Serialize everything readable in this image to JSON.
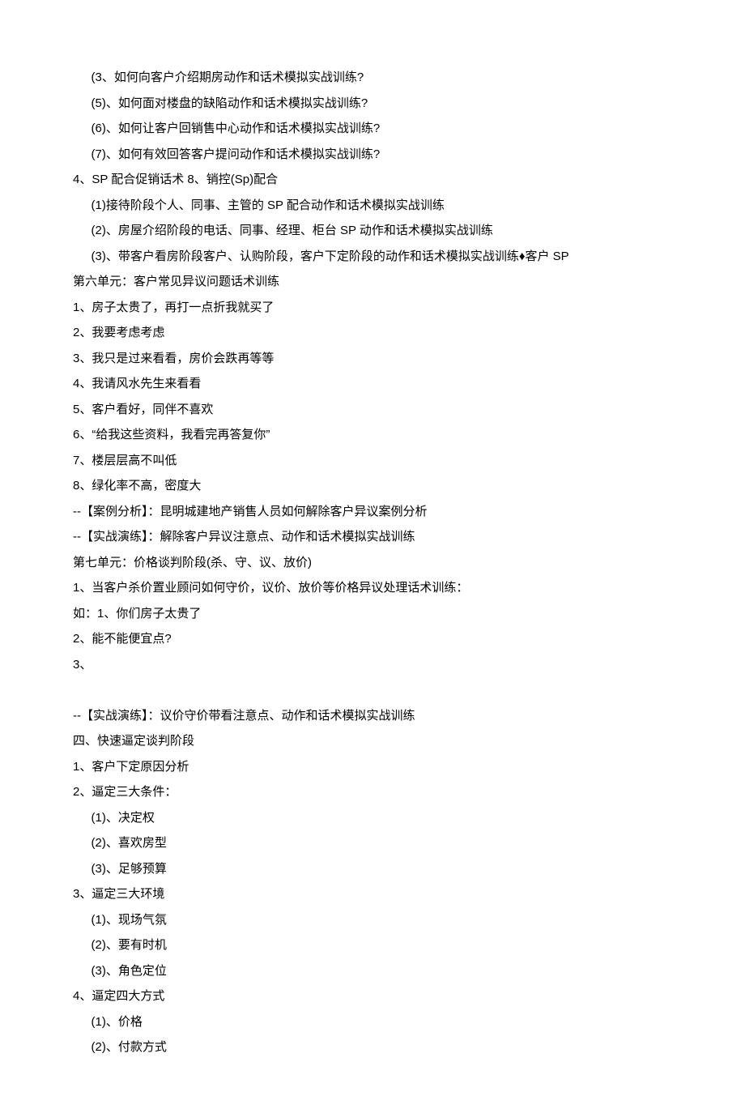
{
  "lines": [
    {
      "text": "(3、如何向客户介绍期房动作和话术模拟实战训练?",
      "indent": 1
    },
    {
      "text": "(5)、如何面对楼盘的缺陷动作和话术模拟实战训练?",
      "indent": 1
    },
    {
      "text": "(6)、如何让客户回销售中心动作和话术模拟实战训练?",
      "indent": 1
    },
    {
      "text": "(7)、如何有效回答客户提问动作和话术模拟实战训练?",
      "indent": 1
    },
    {
      "text": "4、SP 配合促销话术 8、销控(Sp)配合",
      "indent": 0
    },
    {
      "text": "(1)接待阶段个人、同事、主管的 SP 配合动作和话术模拟实战训练",
      "indent": 1
    },
    {
      "text": "(2)、房屋介绍阶段的电话、同事、经理、柜台 SP 动作和话术模拟实战训练",
      "indent": 1
    },
    {
      "text": "(3)、带客户看房阶段客户、认购阶段，客户下定阶段的动作和话术模拟实战训练♦客户 SP",
      "indent": 1
    },
    {
      "text": "第六单元：客户常见异议问题话术训练",
      "indent": 0,
      "section": true
    },
    {
      "text": "1、房子太贵了，再打一点折我就买了",
      "indent": 0
    },
    {
      "text": "2、我要考虑考虑",
      "indent": 0
    },
    {
      "text": "3、我只是过来看看，房价会跌再等等",
      "indent": 0
    },
    {
      "text": "4、我请风水先生来看看",
      "indent": 0
    },
    {
      "text": "5、客户看好，同伴不喜欢",
      "indent": 0
    },
    {
      "text": "6、“给我这些资料，我看完再答复你”",
      "indent": 0
    },
    {
      "text": "7、楼层层高不叫低",
      "indent": 0
    },
    {
      "text": "8、绿化率不高，密度大",
      "indent": 0
    },
    {
      "text": "--【案例分析】：昆明城建地产销售人员如何解除客户异议案例分析",
      "indent": 0
    },
    {
      "text": "--【实战演练】：解除客户异议注意点、动作和话术模拟实战训练",
      "indent": 0
    },
    {
      "text": "第七单元：价格谈判阶段(杀、守、议、放价)",
      "indent": 0
    },
    {
      "text": "1、当客户杀价置业顾问如何守价，议价、放价等价格异议处理话术训练：",
      "indent": 0
    },
    {
      "text": "如：1、你们房子太贵了",
      "indent": 0
    },
    {
      "text": "2、能不能便宜点?",
      "indent": 0
    },
    {
      "text": "3、",
      "indent": 0
    },
    {
      "text": "",
      "indent": 0,
      "blank": true
    },
    {
      "text": "--【实战演练】：议价守价带看注意点、动作和话术模拟实战训练",
      "indent": 0
    },
    {
      "text": "四、快速逼定谈判阶段",
      "indent": 0
    },
    {
      "text": "1、客户下定原因分析",
      "indent": 0
    },
    {
      "text": "2、逼定三大条件：",
      "indent": 0
    },
    {
      "text": "(1)、决定权",
      "indent": 1
    },
    {
      "text": "(2)、喜欢房型",
      "indent": 1
    },
    {
      "text": "(3)、足够预算",
      "indent": 1
    },
    {
      "text": "3、逼定三大环境",
      "indent": 0
    },
    {
      "text": "(1)、现场气氛",
      "indent": 1
    },
    {
      "text": "(2)、要有时机",
      "indent": 1
    },
    {
      "text": "(3)、角色定位",
      "indent": 1
    },
    {
      "text": "4、逼定四大方式",
      "indent": 0
    },
    {
      "text": "(1)、价格",
      "indent": 1
    },
    {
      "text": "(2)、付款方式",
      "indent": 1
    }
  ]
}
